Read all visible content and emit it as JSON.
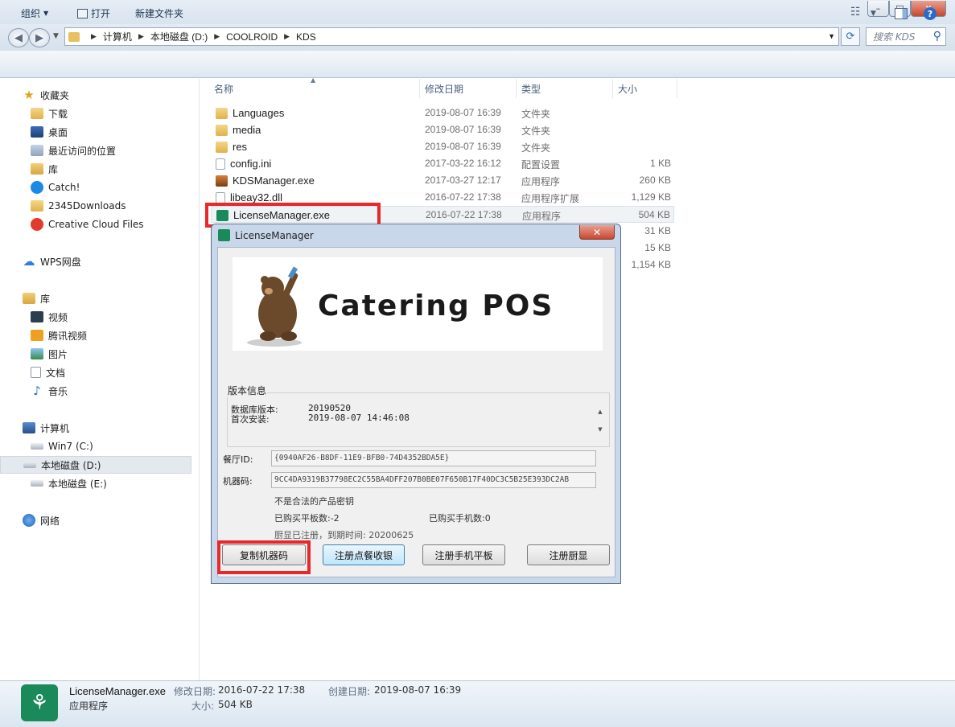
{
  "window": {
    "minimize_glyph": "–",
    "maximize_glyph": "□",
    "close_glyph": "✕"
  },
  "address": {
    "crumbs": [
      "计算机",
      "本地磁盘 (D:)",
      "COOLROID",
      "KDS"
    ],
    "search_placeholder": "搜索 KDS"
  },
  "toolbar": {
    "organize": "组织",
    "open": "打开",
    "new_folder": "新建文件夹"
  },
  "nav": {
    "favorites": "收藏夹",
    "downloads": "下载",
    "desktop": "桌面",
    "recent": "最近访问的位置",
    "lib_fav": "库",
    "catch": "Catch!",
    "dl2345": "2345Downloads",
    "creative_cloud": "Creative Cloud Files",
    "wps": "WPS网盘",
    "libraries": "库",
    "videos": "视频",
    "tencent_video": "腾讯视频",
    "pictures": "图片",
    "documents": "文档",
    "music": "音乐",
    "computer": "计算机",
    "drive_c": "Win7 (C:)",
    "drive_d": "本地磁盘 (D:)",
    "drive_e": "本地磁盘 (E:)",
    "network": "网络"
  },
  "columns": {
    "name": "名称",
    "date": "修改日期",
    "type": "类型",
    "size": "大小"
  },
  "files": [
    {
      "name": "Languages",
      "date": "2019-08-07 16:39",
      "type": "文件夹",
      "size": "",
      "icon": "folder-icon"
    },
    {
      "name": "media",
      "date": "2019-08-07 16:39",
      "type": "文件夹",
      "size": "",
      "icon": "folder-icon"
    },
    {
      "name": "res",
      "date": "2019-08-07 16:39",
      "type": "文件夹",
      "size": "",
      "icon": "folder-icon"
    },
    {
      "name": "config.ini",
      "date": "2017-03-22 16:12",
      "type": "配置设置",
      "size": "1 KB",
      "icon": "config-file-icon"
    },
    {
      "name": "KDSManager.exe",
      "date": "2017-03-27 12:17",
      "type": "应用程序",
      "size": "260 KB",
      "icon": "kds-app-icon"
    },
    {
      "name": "libeay32.dll",
      "date": "2016-07-22 17:38",
      "type": "应用程序扩展",
      "size": "1,129 KB",
      "icon": "dll-file-icon"
    },
    {
      "name": "LicenseManager.exe",
      "date": "2016-07-22 17:38",
      "type": "应用程序",
      "size": "504 KB",
      "icon": "license-app-icon"
    }
  ],
  "hidden_sizes": [
    "31 KB",
    "15 KB",
    "1,154 KB"
  ],
  "dialog": {
    "title": "LicenseManager",
    "close_glyph": "✕",
    "banner_text": "Catering POS",
    "version_group": "版本信息",
    "db_version_label": "数据库版本:",
    "db_version_value": "20190520",
    "first_install_label": "首次安装:",
    "first_install_value": "2019-08-07 14:46:08",
    "restaurant_id_label": "餐厅ID:",
    "restaurant_id_value": "{0940AF26-B8DF-11E9-BFB0-74D4352BDA5E}",
    "machine_code_label": "机器码:",
    "machine_code_value": "9CC4DA9319B37798EC2C55BA4DFF207B0BE07F650B17F40DC3C5B25E393DC2AB",
    "invalid_key": "不是合法的产品密钥",
    "tablets_bought": "已购买平板数:-2",
    "phones_bought": "已购买手机数:0",
    "kitchen_registered": "厨显已注册，到期时间: 20200625",
    "btn_copy": "复制机器码",
    "btn_reg_pos": "注册点餐收银",
    "btn_reg_mobile": "注册手机平板",
    "btn_reg_kitchen": "注册厨显"
  },
  "status": {
    "name": "LicenseManager.exe",
    "kind": "应用程序",
    "modified_label": "修改日期:",
    "modified_value": "2016-07-22 17:38",
    "created_label": "创建日期:",
    "created_value": "2019-08-07 16:39",
    "size_label": "大小:",
    "size_value": "504 KB"
  },
  "colors": {
    "highlight_box": "#e8282b",
    "app_green": "#1b8a5a"
  }
}
